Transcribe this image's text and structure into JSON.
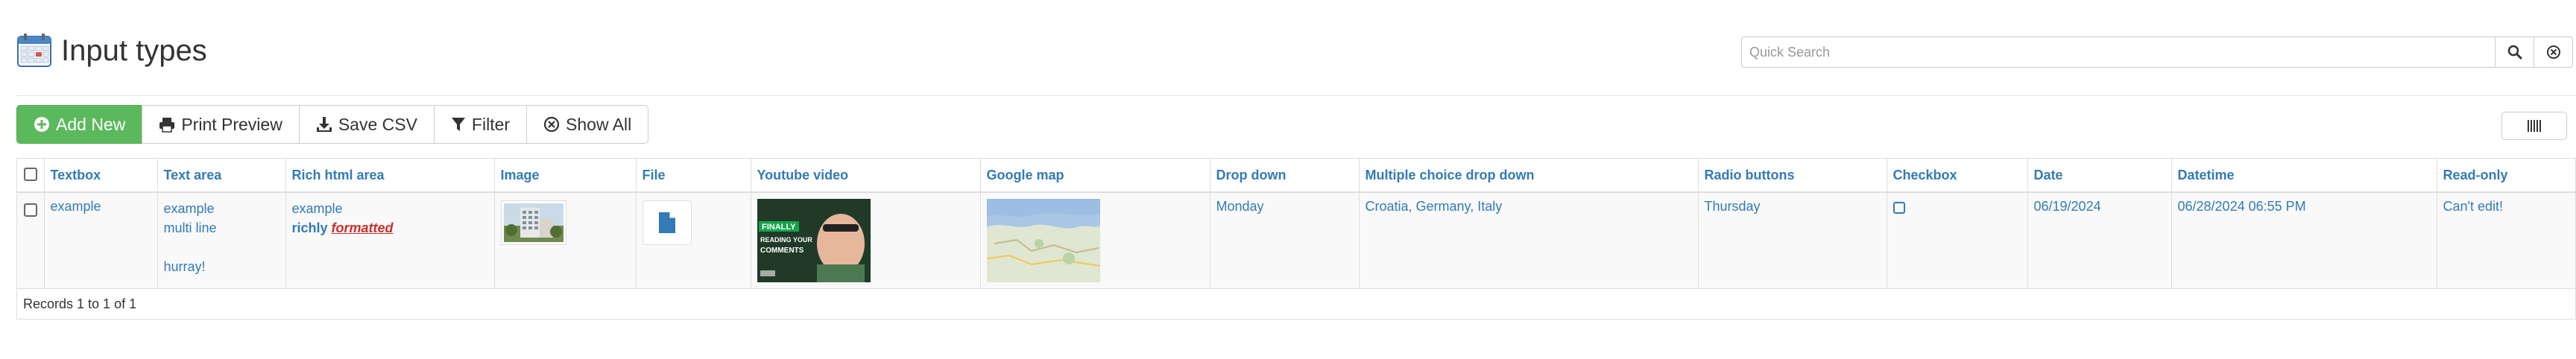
{
  "header": {
    "title": "Input types",
    "search_placeholder": "Quick Search"
  },
  "toolbar": {
    "add_new": "Add New",
    "print_preview": "Print Preview",
    "save_csv": "Save CSV",
    "filter": "Filter",
    "show_all": "Show All"
  },
  "table": {
    "columns": [
      "Textbox",
      "Text area",
      "Rich html area",
      "Image",
      "File",
      "Youtube video",
      "Google map",
      "Drop down",
      "Multiple choice drop down",
      "Radio buttons",
      "Checkbox",
      "Date",
      "Datetime",
      "Read-only"
    ],
    "row": {
      "textbox": "example",
      "textarea_lines": [
        "example",
        "multi line",
        "",
        "hurray!"
      ],
      "rich_bold": "richly",
      "rich_formatted": "formatted",
      "rich_first": "example",
      "video_text_1": "FINALLY",
      "video_text_2": "READING YOUR",
      "video_text_3": "COMMENTS",
      "dropdown": "Monday",
      "multi_choice": "Croatia, Germany, Italy",
      "radio": "Thursday",
      "checkbox_checked": false,
      "date": "06/19/2024",
      "datetime": "06/28/2024 06:55 PM",
      "readonly": "Can't edit!"
    },
    "footer": "Records 1 to 1 of 1"
  },
  "colors": {
    "link": "#337ab7",
    "green": "#5cb85c",
    "red": "#c9302c"
  }
}
